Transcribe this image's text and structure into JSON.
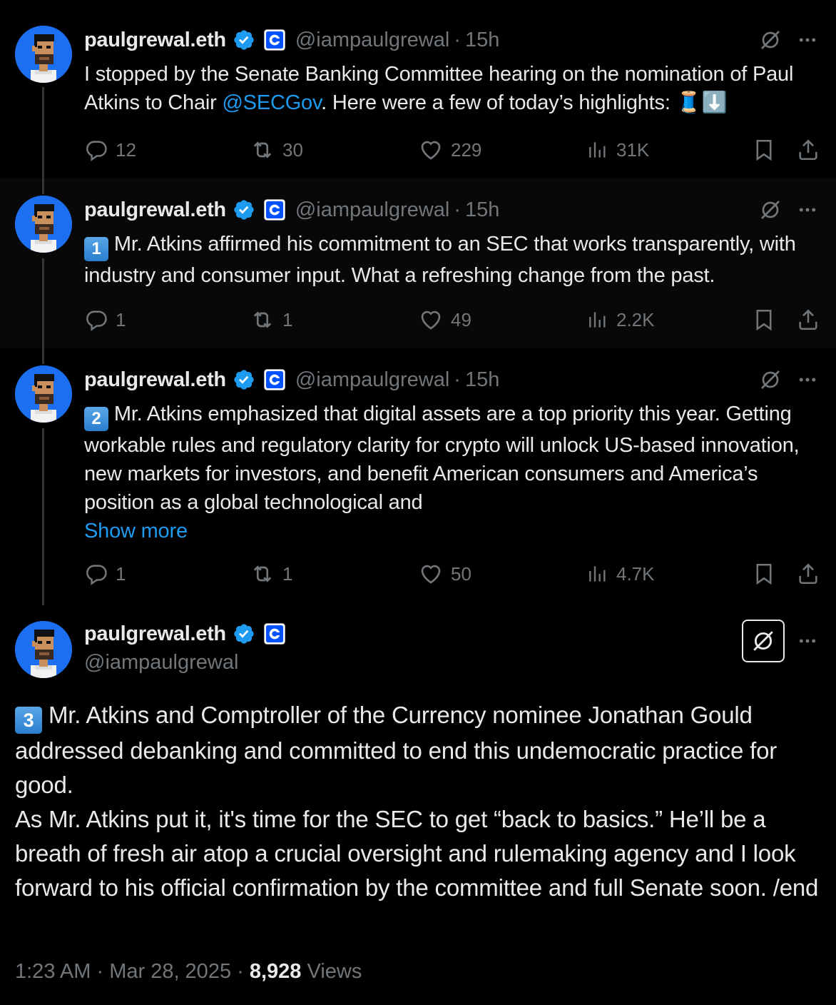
{
  "author": {
    "name": "paulgrewal.eth",
    "handle": "@iampaulgrewal"
  },
  "colors": {
    "background": "#000000",
    "text": "#e7e9ea",
    "muted": "#71767b",
    "link": "#1d9bf0",
    "avatar_bg": "#1d6ff2",
    "verified": "#1d9bf0",
    "coinbase": "#0052ff"
  },
  "tweets": [
    {
      "time": "15h",
      "text_before": "I stopped by the Senate Banking Committee hearing on the nomination of Paul Atkins to Chair ",
      "mention": "@SECGov",
      "text_after": ". Here were a few of today’s highlights: 🧵⬇️",
      "replies": "12",
      "reposts": "30",
      "likes": "229",
      "views": "31K"
    },
    {
      "time": "15h",
      "number_emoji": "1",
      "text": " Mr. Atkins affirmed his commitment to an SEC that works transparently, with industry and consumer input. What a refreshing change from the past.",
      "replies": "1",
      "reposts": "1",
      "likes": "49",
      "views": "2.2K"
    },
    {
      "time": "15h",
      "number_emoji": "2",
      "text": " Mr. Atkins emphasized that digital assets are a top priority this year. Getting workable rules and regulatory clarity for crypto will unlock US-based innovation, new markets for investors, and benefit American consumers and America’s position as a global technological and",
      "show_more": "Show more",
      "replies": "1",
      "reposts": "1",
      "likes": "50",
      "views": "4.7K"
    }
  ],
  "main_tweet": {
    "number_emoji": "3",
    "paragraph1": " Mr. Atkins and Comptroller of the Currency nominee Jonathan Gould addressed debanking and committed to end this undemocratic practice for good.",
    "paragraph2": "As Mr. Atkins put it, it's time for the SEC to get “back to basics.” He’ll be a breath of fresh air atop a crucial oversight and rulemaking agency and I look forward to his official confirmation by the committee and full Senate soon. /end",
    "time": "1:23 AM",
    "date": "Mar 28, 2025",
    "views_count": "8,928",
    "views_label": "Views"
  },
  "icons": {
    "reply": "reply-icon",
    "repost": "repost-icon",
    "like": "heart-icon",
    "views": "views-chart-icon",
    "bookmark": "bookmark-icon",
    "share": "share-icon",
    "grok": "grok-icon",
    "more": "more-icon",
    "verified": "verified-badge-icon",
    "affiliate": "coinbase-badge-icon"
  }
}
